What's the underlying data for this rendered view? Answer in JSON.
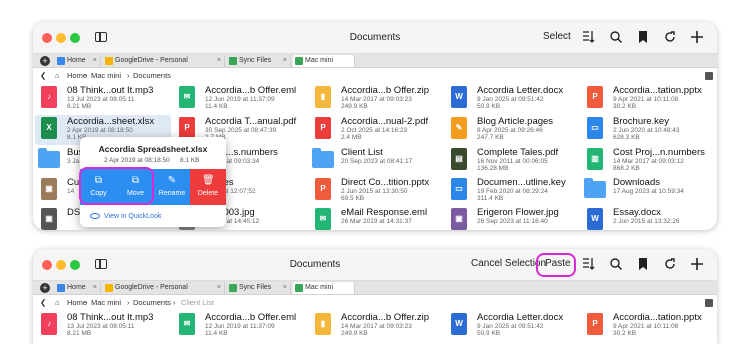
{
  "window1": {
    "title": "Documents",
    "select_label": "Select",
    "tabs": [
      {
        "label": "Home",
        "color": "#3a86e8"
      },
      {
        "label": "GoogleDrive - Personal",
        "color": "#f4b400"
      },
      {
        "label": "Sync Files",
        "color": "#3aa757"
      },
      {
        "label": "Mac mini",
        "color": "#3aa757",
        "active": true
      }
    ],
    "path": [
      "Home",
      "Mac mini",
      "Documents"
    ],
    "popup": {
      "title": "Accordia Spreadsheet.xlsx",
      "date": "2 Apr 2019 at 08:18:50",
      "size": "8.1 KB",
      "actions": [
        "Copy",
        "Move",
        "Rename",
        "Delete"
      ],
      "quicklook": "View in QuickLook"
    }
  },
  "window2": {
    "title": "Documents",
    "cancel_label": "Cancel Selection",
    "paste_label": "Paste",
    "path": [
      "Home",
      "Mac mini",
      "Documents",
      "Client List"
    ]
  },
  "files_row1": [
    {
      "name": "08 Think...out It.mp3",
      "date": "13 Jul 2023 at 08:05:11",
      "size": "8.21 MB",
      "icon": "music",
      "color": "#f0405c"
    },
    {
      "name": "Accordia...b Offer.eml",
      "date": "12 Jun 2019 at 11:37:09",
      "size": "11.4 KB",
      "icon": "mail",
      "color": "#22b573"
    },
    {
      "name": "Accordia...b Offer.zip",
      "date": "14 Mar 2017 at 09:03:23",
      "size": "249.9 KB",
      "icon": "zip",
      "color": "#f3b83b"
    },
    {
      "name": "Accordia Letter.docx",
      "date": "9 Jan 2025 at 09:51:42",
      "size": "50.9 KB",
      "icon": "W",
      "color": "#2b6cd4"
    },
    {
      "name": "Accordia...tation.pptx",
      "date": "9 Apr 2021 at 10:11:08",
      "size": "30.2 KB",
      "icon": "P",
      "color": "#ef5b3c"
    }
  ],
  "files_row2": [
    {
      "name": "Accordia...sheet.xlsx",
      "date": "2 Apr 2019 at 08:18:50",
      "size": "8.1 KB",
      "icon": "X",
      "color": "#1e8e4e"
    },
    {
      "name": "Accordia T...anual.pdf",
      "date": "30 Sep 2025 at 08:47:39",
      "size": "2.7 MB",
      "icon": "pdf",
      "color": "#ee3b3b"
    },
    {
      "name": "Accordia...nual-2.pdf",
      "date": "2 Oct 2025 at 14:16:23",
      "size": "2.4 MB",
      "icon": "pdf",
      "color": "#ee3b3b"
    },
    {
      "name": "Blog Article.pages",
      "date": "8 Apr 2025 at 09:26:46",
      "size": "247.7 KB",
      "icon": "pages",
      "color": "#f39c1f"
    },
    {
      "name": "Brochure.key",
      "date": "2 Jun 2020 at 10:48:43",
      "size": "628.3 KB",
      "icon": "key",
      "color": "#2b86e8"
    }
  ],
  "files_row3": [
    {
      "name": "Bus",
      "date": "3 Ja",
      "size": "",
      "icon": "folder",
      "color": "#4ea3f2"
    },
    {
      "name": "...ing...s.numbers",
      "date": "...2017 at 09:03:34",
      "size": "",
      "icon": "numbers",
      "color": "#22b573"
    },
    {
      "name": "Client List",
      "date": "20 Sep 2023 at 08:41:17",
      "size": "",
      "icon": "folder",
      "color": "#4ea3f2"
    },
    {
      "name": "Complete Tales.pdf",
      "date": "16 Nov 2011 at 00:06:05",
      "size": "136.28 MB",
      "icon": "book",
      "color": "#3a4a2c"
    },
    {
      "name": "Cost Proj...n.numbers",
      "date": "14 Mar 2017 at 09:03:12",
      "size": "868.2 KB",
      "icon": "numbers",
      "color": "#22b573"
    }
  ],
  "files_row4": [
    {
      "name": "Cu",
      "date": "14",
      "size": "",
      "icon": "img",
      "color": "#9a7b5a"
    },
    {
      "name": "...ages",
      "date": "...020 at 12:07:52",
      "size": "",
      "icon": "img",
      "color": "#777"
    },
    {
      "name": "Direct Co...tition.pptx",
      "date": "2 Jun 2015 at 13:30:50",
      "size": "69.5 KB",
      "icon": "P",
      "color": "#ef5b3c"
    },
    {
      "name": "Documen...utline.key",
      "date": "19 Feb 2020 at 08:29:24",
      "size": "311.4 KB",
      "icon": "key",
      "color": "#2b86e8"
    },
    {
      "name": "Downloads",
      "date": "17 Aug 2023 at 10:59:34",
      "size": "",
      "icon": "folder",
      "color": "#4ea3f2"
    }
  ],
  "files_row5": [
    {
      "name": "DS(",
      "date": "",
      "size": "",
      "icon": "img",
      "color": "#555"
    },
    {
      "name": "...09003.jpg",
      "date": "...2018 at 14:45:12",
      "size": "",
      "icon": "img",
      "color": "#888"
    },
    {
      "name": "eMail Response.eml",
      "date": "26 Mar 2019 at 14:31:37",
      "size": "",
      "icon": "mail",
      "color": "#22b573"
    },
    {
      "name": "Erigeron Flower.jpg",
      "date": "26 Sep 2023 at 11:16:40",
      "size": "",
      "icon": "img",
      "color": "#7a5aa0"
    },
    {
      "name": "Essay.docx",
      "date": "2 Jun 2015 at 13:32:26",
      "size": "",
      "icon": "W",
      "color": "#2b6cd4"
    }
  ]
}
